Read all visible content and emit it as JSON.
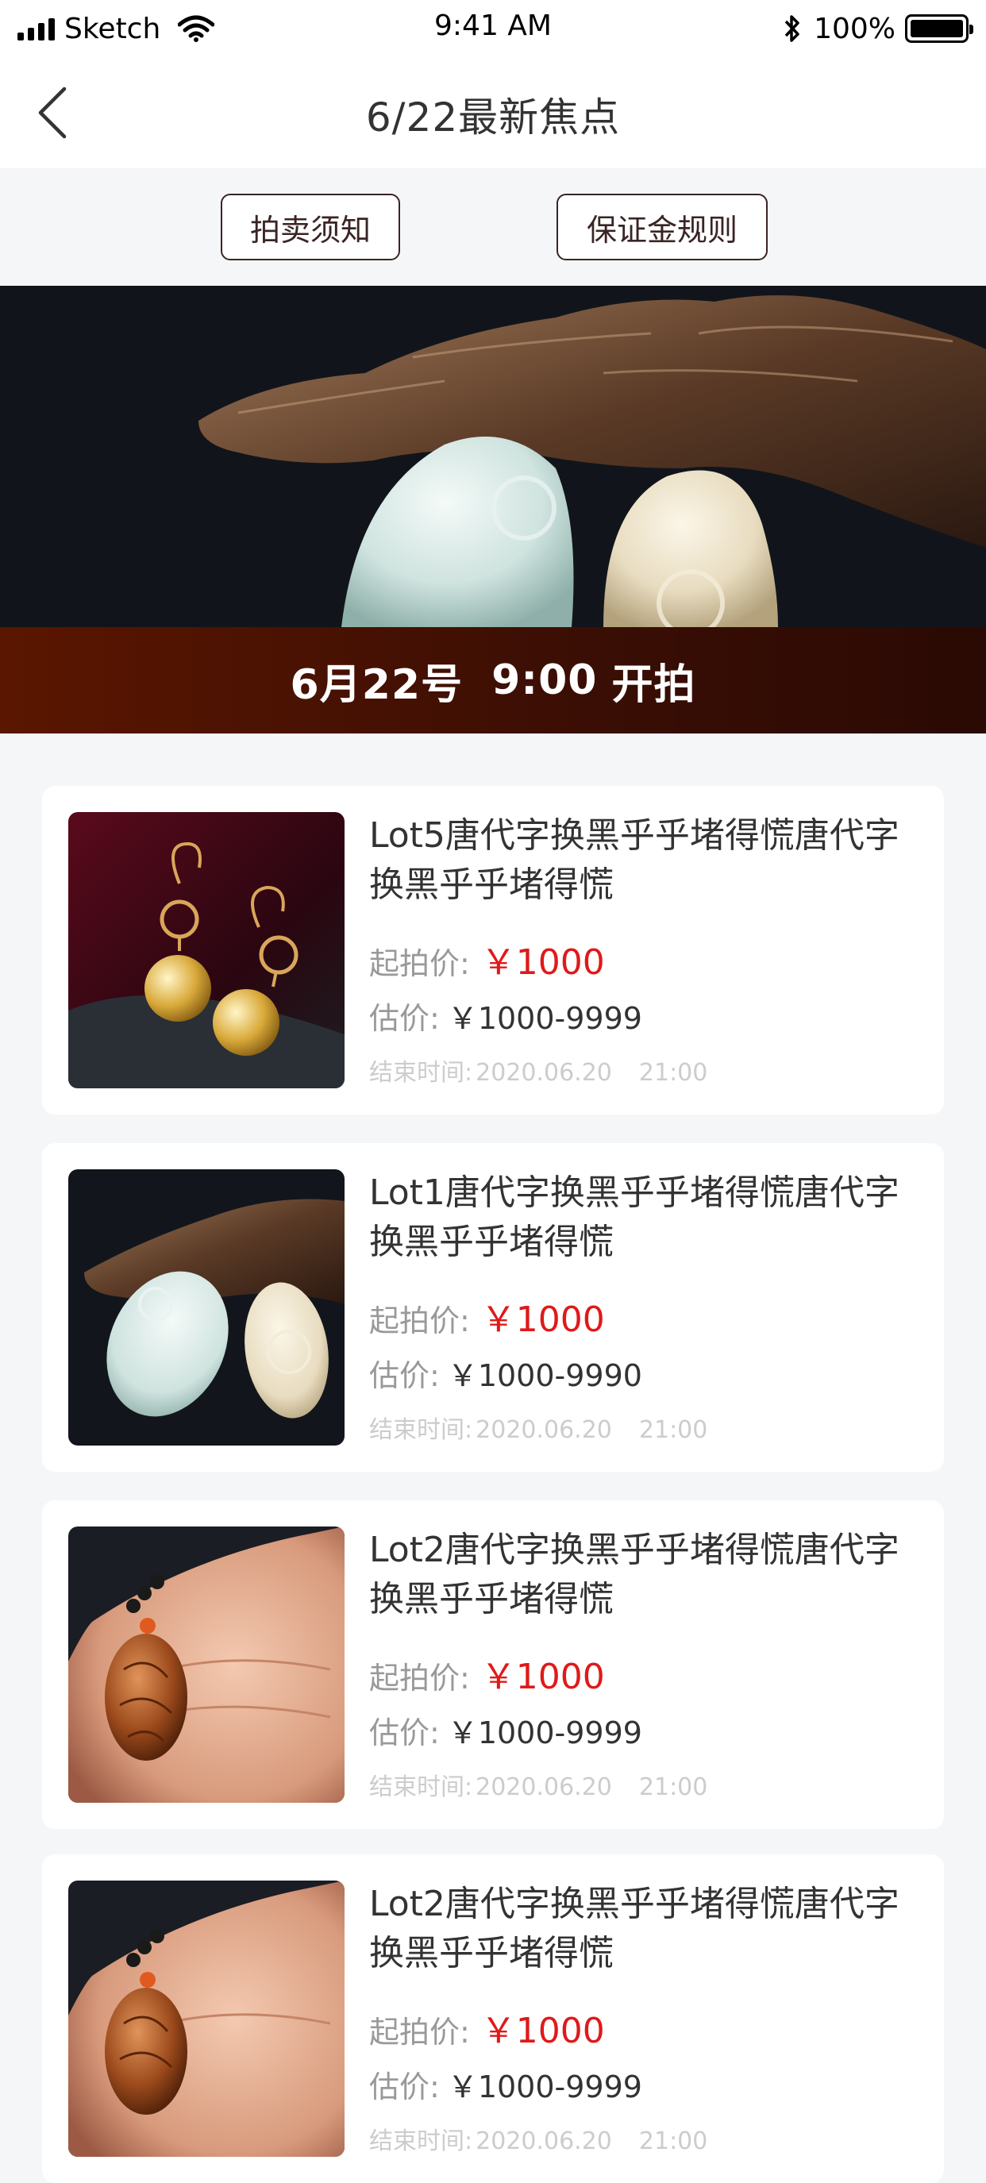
{
  "status_bar": {
    "carrier": "Sketch",
    "time": "9:41 AM",
    "battery": "100%"
  },
  "nav": {
    "title": "6/22最新焦点"
  },
  "actions": {
    "rules_label": "拍卖须知",
    "deposit_label": "保证金规则"
  },
  "banner": {
    "date": "6月22号",
    "time": "9:00",
    "action": "开拍"
  },
  "lots": [
    {
      "title": "Lot5唐代字换黑乎乎堵得慌唐代字换黑乎乎堵得慌",
      "start_label": "起拍价:",
      "start_price": "￥1000",
      "est_label": "估价:",
      "est_price": "￥1000-9999",
      "end_label": "结束时间:",
      "end_date": "2020.06.20",
      "end_time": "21:00",
      "image": "pearl-earrings"
    },
    {
      "title": "Lot1唐代字换黑乎乎堵得慌唐代字换黑乎乎堵得慌",
      "start_label": "起拍价:",
      "start_price": "￥1000",
      "est_label": "估价:",
      "est_price": "￥1000-9990",
      "end_label": "结束时间:",
      "end_date": "2020.06.20",
      "end_time": "21:00",
      "image": "jade-pendants"
    },
    {
      "title": "Lot2唐代字换黑乎乎堵得慌唐代字换黑乎乎堵得慌",
      "start_label": "起拍价:",
      "start_price": "￥1000",
      "est_label": "估价:",
      "est_price": "￥1000-9999",
      "end_label": "结束时间:",
      "end_date": "2020.06.20",
      "end_time": "21:00",
      "image": "carved-pendant-in-hand"
    },
    {
      "title": "Lot2唐代字换黑乎乎堵得慌唐代字换黑乎乎堵得慌",
      "start_label": "起拍价:",
      "start_price": "￥1000",
      "est_label": "估价:",
      "est_price": "￥1000-9999",
      "end_label": "结束时间:",
      "end_date": "2020.06.20",
      "end_time": "21:00",
      "image": "carved-pendant-in-hand"
    }
  ],
  "colors": {
    "price_red": "#e0191a",
    "button_border": "#3a2424",
    "banner_gradient": "#5a1600"
  }
}
